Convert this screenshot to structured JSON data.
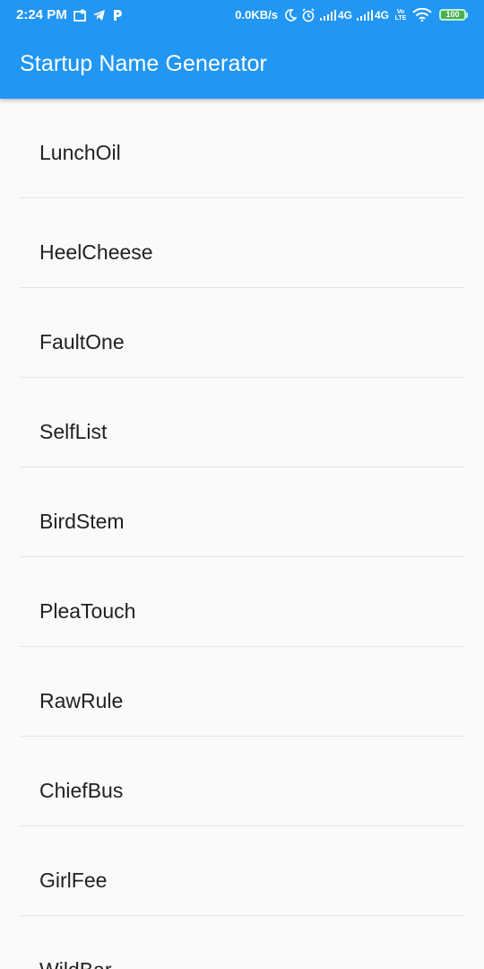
{
  "status_bar": {
    "time": "2:24 PM",
    "net_speed": "0.0KB/s",
    "signal1_label": "4G",
    "signal2_label": "4G",
    "volte_label": "Vo LTE",
    "battery": "100"
  },
  "app_bar": {
    "title": "Startup Name Generator"
  },
  "list": {
    "items": [
      "LunchOil",
      "HeelCheese",
      "FaultOne",
      "SelfList",
      "BirdStem",
      "PleaTouch",
      "RawRule",
      "ChiefBus",
      "GirlFee",
      "WildBar"
    ]
  }
}
